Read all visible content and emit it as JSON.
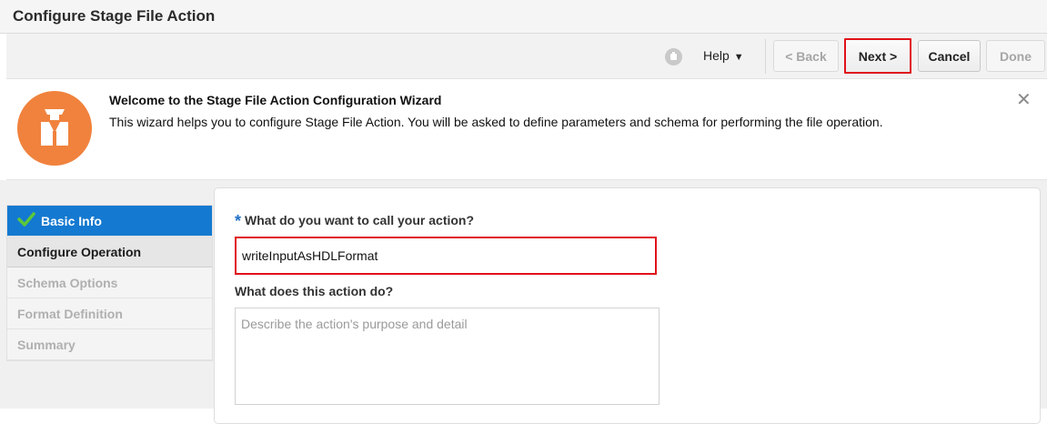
{
  "window": {
    "title": "Configure Stage File Action"
  },
  "toolbar": {
    "help_label": "Help",
    "back_label": "< Back",
    "next_label": "Next >",
    "cancel_label": "Cancel",
    "done_label": "Done",
    "icons": {
      "status": "status-icon",
      "help_caret": "caret-down-icon"
    }
  },
  "welcome": {
    "title": "Welcome to the Stage File Action Configuration Wizard",
    "text": "This wizard helps you to configure Stage File Action. You will be asked to define parameters and schema for performing the file operation.",
    "icon": "stage-file-action-icon",
    "close_icon": "close-icon"
  },
  "steps": [
    {
      "label": "Basic Info",
      "state": "completed"
    },
    {
      "label": "Configure Operation",
      "state": "current"
    },
    {
      "label": "Schema Options",
      "state": "disabled"
    },
    {
      "label": "Format Definition",
      "state": "disabled"
    },
    {
      "label": "Summary",
      "state": "disabled"
    }
  ],
  "form": {
    "name_label": "What do you want to call your action?",
    "required_marker": "*",
    "name_value": "writeInputAsHDLFormat",
    "desc_label": "What does this action do?",
    "desc_placeholder": "Describe the action's purpose and detail"
  },
  "colors": {
    "accent": "#1479d0",
    "highlight": "#e0111a",
    "logo": "#f0823d"
  }
}
